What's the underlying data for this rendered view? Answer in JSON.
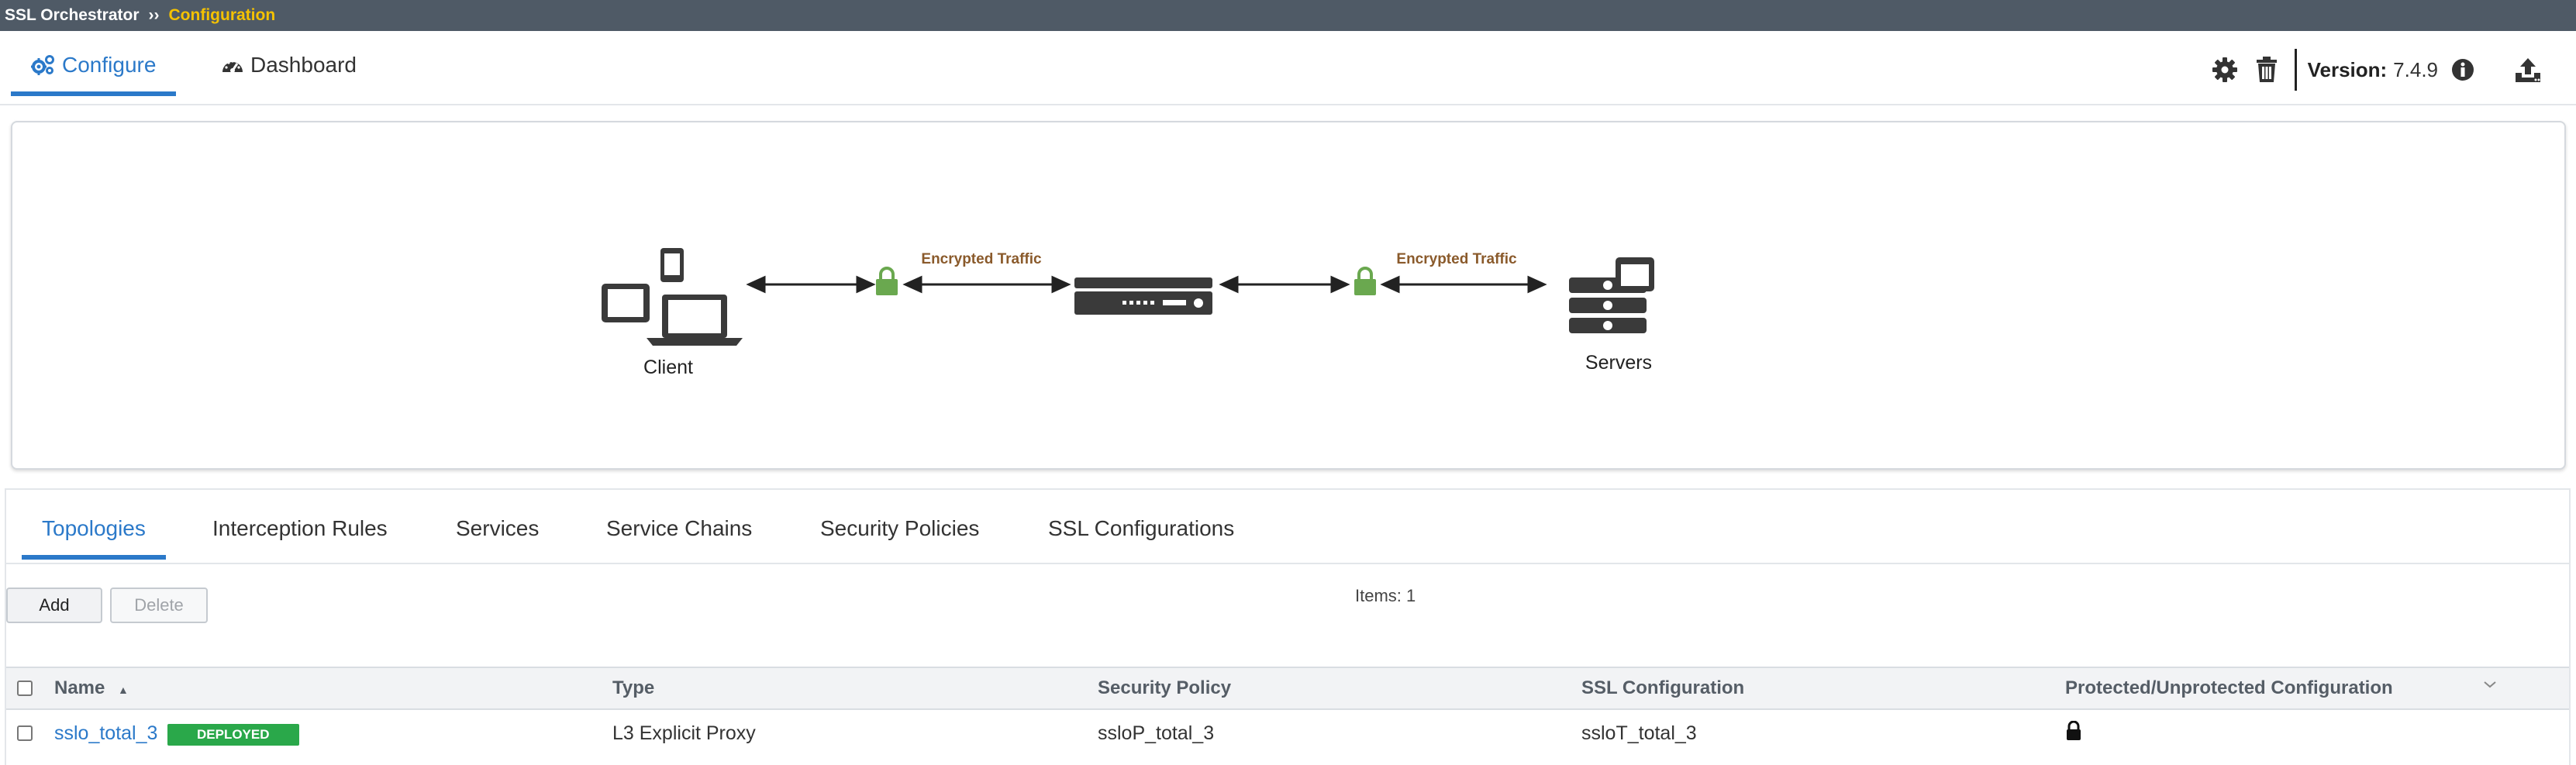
{
  "breadcrumb": {
    "root": "SSL Orchestrator",
    "separator": "››",
    "current": "Configuration"
  },
  "nav": {
    "tabs": [
      {
        "label": "Configure"
      },
      {
        "label": "Dashboard"
      }
    ],
    "version_label": "Version:",
    "version_value": "7.4.9",
    "icons": [
      "gear-icon",
      "trash-icon",
      "info-icon",
      "upload-icon"
    ]
  },
  "diagram": {
    "client_label": "Client",
    "servers_label": "Servers",
    "left_traffic_label": "Encrypted Traffic",
    "right_traffic_label": "Encrypted Traffic",
    "colors": {
      "lock": "#6aa84f",
      "traffic_text": "#8a5a2b",
      "device": "#3a3a3a"
    }
  },
  "sections": {
    "tabs": [
      {
        "label": "Topologies"
      },
      {
        "label": "Interception Rules"
      },
      {
        "label": "Services"
      },
      {
        "label": "Service Chains"
      },
      {
        "label": "Security Policies"
      },
      {
        "label": "SSL Configurations"
      }
    ],
    "add_label": "Add",
    "delete_label": "Delete",
    "items_count": "Items: 1"
  },
  "table": {
    "columns": [
      "Name",
      "Type",
      "Security Policy",
      "SSL Configuration",
      "Protected/Unprotected Configuration"
    ],
    "rows": [
      {
        "name": "sslo_total_3",
        "status": "DEPLOYED",
        "type": "L3 Explicit Proxy",
        "security_policy": "ssloP_total_3",
        "ssl_configuration": "ssloT_total_3",
        "protected_icon": "lock-icon"
      }
    ],
    "colors": {
      "badge": "#2aa84a",
      "accent": "#2b79c9"
    }
  }
}
